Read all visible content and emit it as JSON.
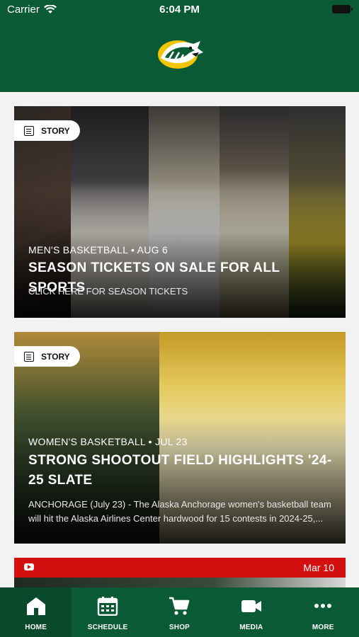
{
  "status_bar": {
    "carrier": "Carrier",
    "time": "6:04 PM"
  },
  "colors": {
    "brand_green": "#0a5a36",
    "brand_gold": "#f2c500",
    "youtube_red": "#d40f0f"
  },
  "feed": {
    "cards": [
      {
        "badge": "STORY",
        "meta": "MEN'S BASKETBALL • AUG 6",
        "title": "SEASON TICKETS ON SALE FOR ALL SPORTS",
        "subtitle": "CLICK HERE FOR SEASON TICKETS"
      },
      {
        "badge": "STORY",
        "meta": "WOMEN'S BASKETBALL • JUL 23",
        "title": "STRONG SHOOTOUT FIELD HIGHLIGHTS '24-25 SLATE",
        "subtitle": "ANCHORAGE (July 23) - The Alaska Anchorage women's basketball team will hit the Alaska Airlines Center hardwood for 15 contests in 2024-25,..."
      },
      {
        "icon": "youtube-icon",
        "date": "Mar 10"
      }
    ]
  },
  "tabbar": {
    "tabs": [
      {
        "label": "HOME",
        "icon": "home-icon",
        "active": true
      },
      {
        "label": "SCHEDULE",
        "icon": "calendar-icon",
        "active": false
      },
      {
        "label": "SHOP",
        "icon": "cart-icon",
        "active": false
      },
      {
        "label": "MEDIA",
        "icon": "video-camera-icon",
        "active": false
      },
      {
        "label": "MORE",
        "icon": "more-icon",
        "active": false
      }
    ]
  }
}
